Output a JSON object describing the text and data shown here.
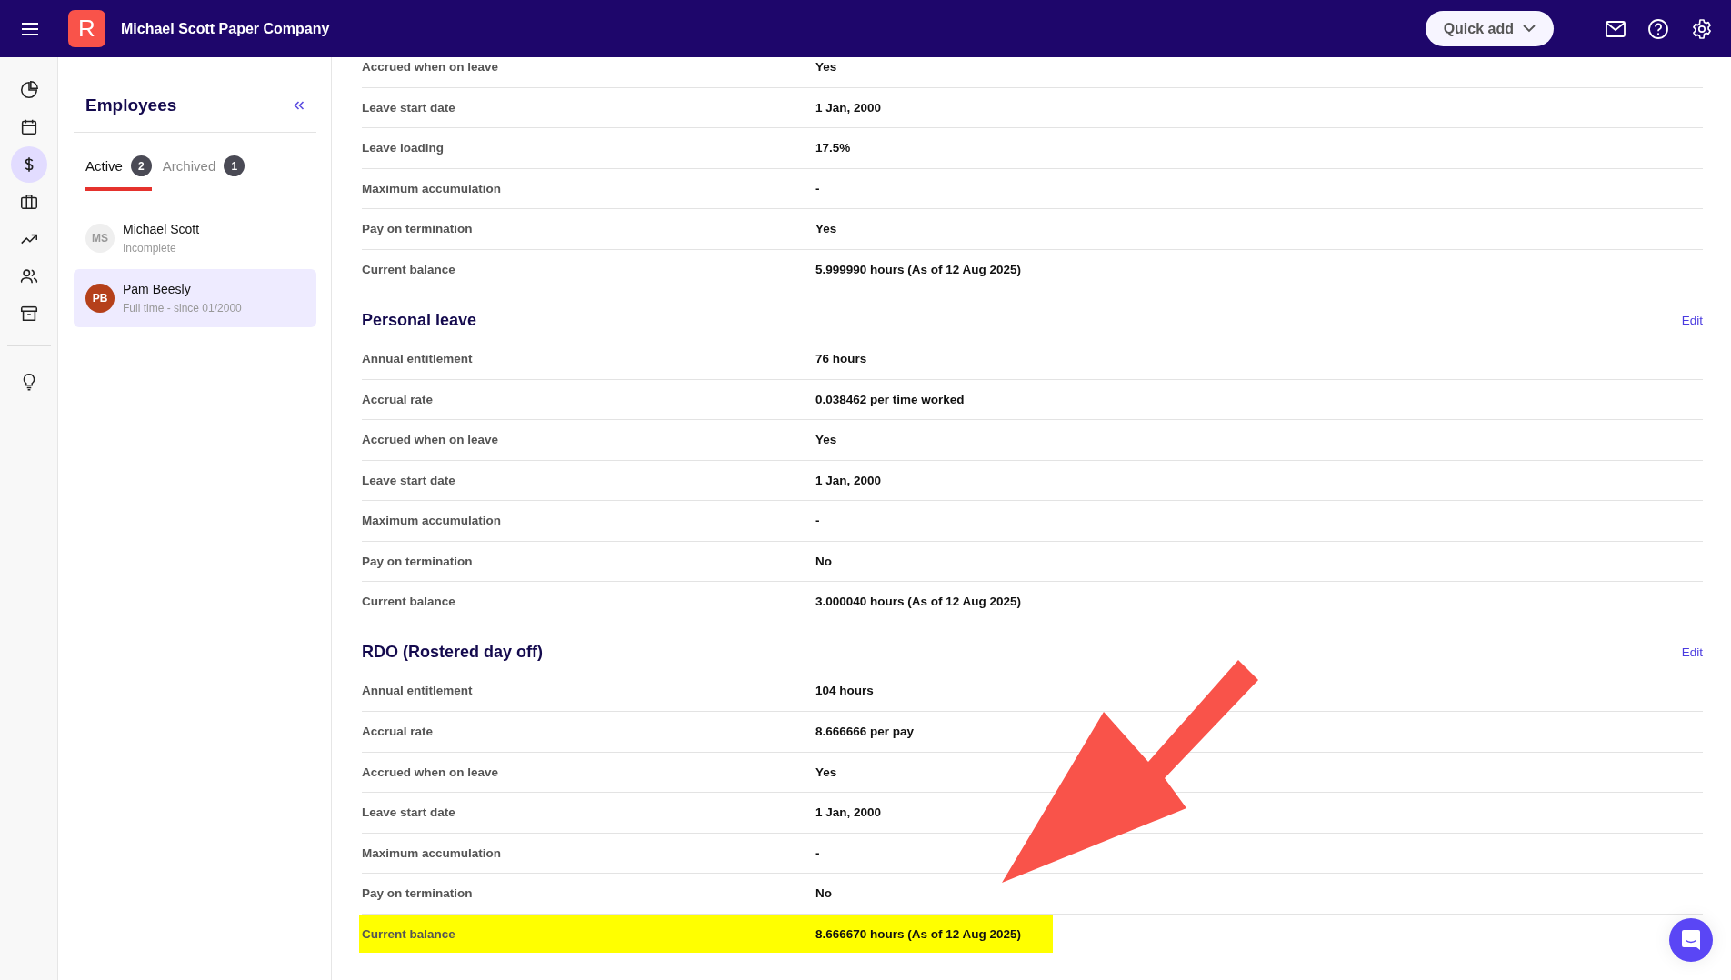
{
  "header": {
    "logo_letter": "R",
    "title": "Michael Scott Paper Company",
    "quick_add": "Quick add"
  },
  "nav_rail": {
    "items": [
      {
        "selected": false
      },
      {
        "selected": false
      },
      {
        "selected": true
      },
      {
        "selected": false
      },
      {
        "selected": false
      },
      {
        "selected": false
      },
      {
        "selected": false
      }
    ]
  },
  "panel": {
    "title": "Employees",
    "tabs": [
      {
        "label": "Active",
        "count": "2",
        "selected": true
      },
      {
        "label": "Archived",
        "count": "1",
        "selected": false
      }
    ],
    "employees": [
      {
        "initials": "MS",
        "name": "Michael Scott",
        "subtitle": "Incomplete",
        "color": "#efefef",
        "selected": false
      },
      {
        "initials": "PB",
        "name": "Pam Beesly",
        "subtitle": "Full time - since 01/2000",
        "color": "#b5401a",
        "selected": true
      }
    ]
  },
  "sections": [
    {
      "rows": [
        {
          "label": "Accrued when on leave",
          "value": "Yes",
          "highlighted": false
        },
        {
          "label": "Leave start date",
          "value": "1 Jan, 2000",
          "highlighted": false
        },
        {
          "label": "Leave loading",
          "value": "17.5%",
          "highlighted": false
        },
        {
          "label": "Maximum accumulation",
          "value": "-",
          "highlighted": false
        },
        {
          "label": "Pay on termination",
          "value": "Yes",
          "highlighted": false
        },
        {
          "label": "Current balance",
          "value": "5.999990 hours (As of 12 Aug 2025)",
          "highlighted": false
        }
      ]
    },
    {
      "title": "Personal leave",
      "edit": "Edit",
      "rows": [
        {
          "label": "Annual entitlement",
          "value": "76 hours",
          "highlighted": false
        },
        {
          "label": "Accrual rate",
          "value": "0.038462 per time worked",
          "highlighted": false
        },
        {
          "label": "Accrued when on leave",
          "value": "Yes",
          "highlighted": false
        },
        {
          "label": "Leave start date",
          "value": "1 Jan, 2000",
          "highlighted": false
        },
        {
          "label": "Maximum accumulation",
          "value": "-",
          "highlighted": false
        },
        {
          "label": "Pay on termination",
          "value": "No",
          "highlighted": false
        },
        {
          "label": "Current balance",
          "value": "3.000040 hours (As of 12 Aug 2025)",
          "highlighted": false
        }
      ]
    },
    {
      "title": "RDO (Rostered day off)",
      "edit": "Edit",
      "rows": [
        {
          "label": "Annual entitlement",
          "value": "104 hours",
          "highlighted": false
        },
        {
          "label": "Accrual rate",
          "value": "8.666666 per pay",
          "highlighted": false
        },
        {
          "label": "Accrued when on leave",
          "value": "Yes",
          "highlighted": false
        },
        {
          "label": "Leave start date",
          "value": "1 Jan, 2000",
          "highlighted": false
        },
        {
          "label": "Maximum accumulation",
          "value": "-",
          "highlighted": false
        },
        {
          "label": "Pay on termination",
          "value": "No",
          "highlighted": false
        },
        {
          "label": "Current balance",
          "value": "8.666670 hours (As of 12 Aug 2025)",
          "highlighted": true
        }
      ]
    }
  ]
}
